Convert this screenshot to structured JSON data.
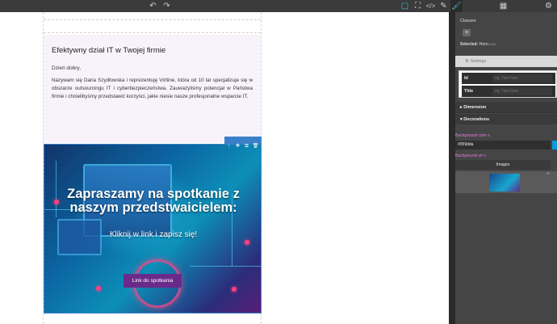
{
  "toolbar": {
    "undo_icon": "↶",
    "redo_icon": "↷",
    "view_components_icon": "▢",
    "fullscreen_icon": "⛶",
    "code_icon": "</>",
    "edit_icon": "✎",
    "style_manager_icon": "🖌",
    "layers_icon": "▦",
    "settings_icon": "⚙"
  },
  "email": {
    "heading": "Efektywny dział IT w Twojej firmie",
    "greeting": "Dzień dobry,",
    "body": "Nazywam się Daria Szydłowska i reprezentuję Virtline, która od 10 lat specjalizuje się w obszarze outsourcingu IT i cyberbezpieczeństwa. Zauważyliśmy potencjał w Państwa firmie i chcielibyśmy przedstawić korzyści, jakie niesie nasze profesjonalne wsparcie IT.",
    "hero_title": "Zapraszamy na spotkanie z naszym przedstwaicielem:",
    "hero_subtitle": "Kliknij w link i zapisz się!",
    "cta_label": "Link do spotkania"
  },
  "element_toolbar": {
    "arrow_up_icon": "↑",
    "move_icon": "✥",
    "copy_icon": "⧉",
    "delete_icon": "🗑"
  },
  "panel": {
    "classes_label": "Classes",
    "add_label": "+",
    "selected_label": "Selected:",
    "selected_value": "Hero",
    "selected_suffix": "float&",
    "settings_label": "⚙ Settings",
    "trait_id_label": "Id",
    "trait_id_placeholder": "eg. Text here",
    "trait_title_label": "Title",
    "trait_title_placeholder": "eg. Text here",
    "dimension_label": "Dimension",
    "decorations_label": "Decorations",
    "bg_color_label": "Background color ≡",
    "bg_color_value": "#059dda",
    "bg_url_label": "Background url ≡",
    "images_label": "Images",
    "close_icon": "×"
  },
  "colors": {
    "accent": "#3fc1d6",
    "selected_border": "#3a80c9",
    "cta_bg": "#6a2a8a",
    "bg_swatch": "#059dda",
    "panel_label": "#e07bd7"
  }
}
